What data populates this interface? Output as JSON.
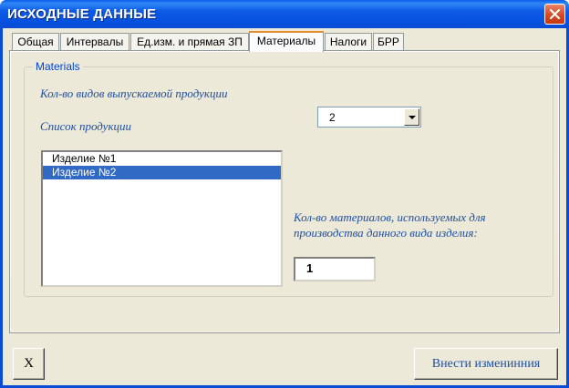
{
  "window": {
    "title": "ИСХОДНЫЕ ДАННЫЕ",
    "title_bar_color": "#0a5ee8",
    "close_icon": "close-icon"
  },
  "tabs": [
    {
      "label": "Общая",
      "active": false
    },
    {
      "label": "Интервалы",
      "active": false
    },
    {
      "label": "Ед.изм. и прямая ЗП",
      "active": false
    },
    {
      "label": "Материалы",
      "active": true
    },
    {
      "label": "Налоги",
      "active": false
    },
    {
      "label": "БРР",
      "active": false
    }
  ],
  "materials": {
    "frame_caption": "Materials",
    "product_count_label": "Кол-во видов выпускаемой продукции",
    "product_count_value": "2",
    "product_list_label": "Список продукции",
    "products": [
      {
        "label": "Изделие №1",
        "selected": false
      },
      {
        "label": "Изделие №2",
        "selected": true
      }
    ],
    "materials_count_label_line1": "Кол-во материалов, используемых для",
    "materials_count_label_line2": "производства данного вида изделия:",
    "materials_count_value": "1"
  },
  "buttons": {
    "close_label": "X",
    "apply_label": "Внести изменинния"
  },
  "colors": {
    "accent_text": "#1f4fa0",
    "selection": "#316ac5",
    "dialog_background": "#ece9d8"
  }
}
